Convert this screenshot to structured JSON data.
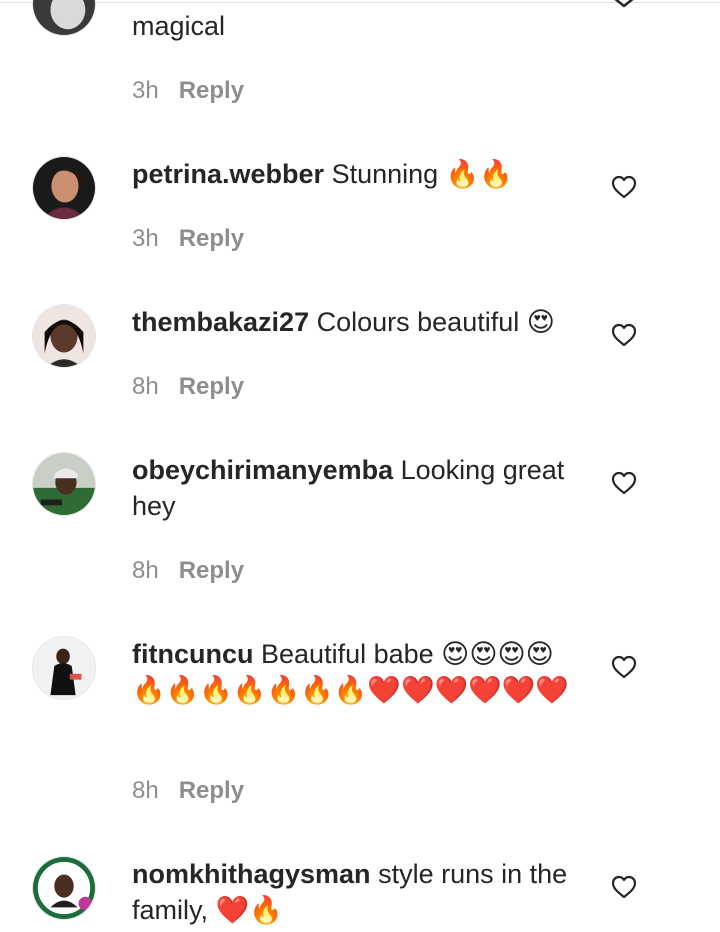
{
  "comments": [
    {
      "username": "",
      "text": "magical",
      "emoji": "",
      "time": "3h",
      "reply": "Reply"
    },
    {
      "username": "petrina.webber",
      "text": "Stunning",
      "emoji": "🔥🔥",
      "time": "3h",
      "reply": "Reply"
    },
    {
      "username": "thembakazi27",
      "text": "Colours beautiful",
      "emoji": "😍",
      "time": "8h",
      "reply": "Reply"
    },
    {
      "username": "obeychirimanyemba",
      "text": "Looking great hey",
      "emoji": "",
      "time": "8h",
      "reply": "Reply"
    },
    {
      "username": "fitncuncu",
      "text": "Beautiful babe",
      "emoji": "😍😍😍😍🔥🔥🔥🔥🔥🔥🔥❤️❤️❤️❤️❤️❤️",
      "time": "8h",
      "reply": "Reply"
    },
    {
      "username": "nomkhithagysman",
      "text": "style runs in the family,",
      "emoji": "❤️🔥",
      "time": "",
      "reply": ""
    }
  ],
  "icons": {
    "like": "heart-outline-icon",
    "collapse": "chevron-down-icon"
  },
  "colors": {
    "text": "#262626",
    "muted": "#8e8e8e",
    "divider": "#e4e4e4"
  }
}
